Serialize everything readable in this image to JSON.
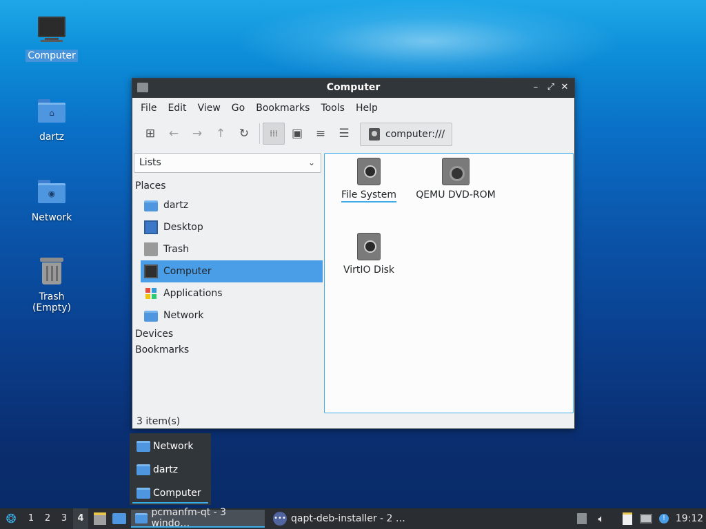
{
  "desktop": {
    "icons": [
      {
        "label": "Computer"
      },
      {
        "label": "dartz"
      },
      {
        "label": "Network"
      },
      {
        "label": "Trash (Empty)"
      }
    ]
  },
  "window": {
    "title": "Computer",
    "menu": [
      "File",
      "Edit",
      "View",
      "Go",
      "Bookmarks",
      "Tools",
      "Help"
    ],
    "path": "computer:///",
    "sidebar_mode": "Lists",
    "sections": {
      "places": "Places",
      "devices": "Devices",
      "bookmarks": "Bookmarks"
    },
    "places": [
      {
        "label": "dartz",
        "icon": "home-folder-icon"
      },
      {
        "label": "Desktop",
        "icon": "desktop-icon"
      },
      {
        "label": "Trash",
        "icon": "trash-icon"
      },
      {
        "label": "Computer",
        "icon": "computer-icon",
        "selected": true
      },
      {
        "label": "Applications",
        "icon": "applications-icon"
      },
      {
        "label": "Network",
        "icon": "network-folder-icon"
      }
    ],
    "files": [
      {
        "label": "File System",
        "icon": "drive-icon"
      },
      {
        "label": "QEMU DVD-ROM",
        "icon": "optical-drive-icon"
      },
      {
        "label": "VirtIO Disk",
        "icon": "drive-icon"
      }
    ],
    "status": "3 item(s)"
  },
  "popup": {
    "items": [
      "Network",
      "dartz",
      "Computer"
    ]
  },
  "taskbar": {
    "desktops": [
      "1",
      "2",
      "3",
      "4"
    ],
    "current_desktop": "4",
    "tasks": [
      {
        "label": "pcmanfm-qt - 3 windo…"
      },
      {
        "label": "qapt-deb-installer - 2 …"
      }
    ],
    "clock": "19:12"
  },
  "colors": {
    "accent": "#3daee9",
    "titlebar": "#31363b",
    "selection": "#4a9ee8"
  }
}
